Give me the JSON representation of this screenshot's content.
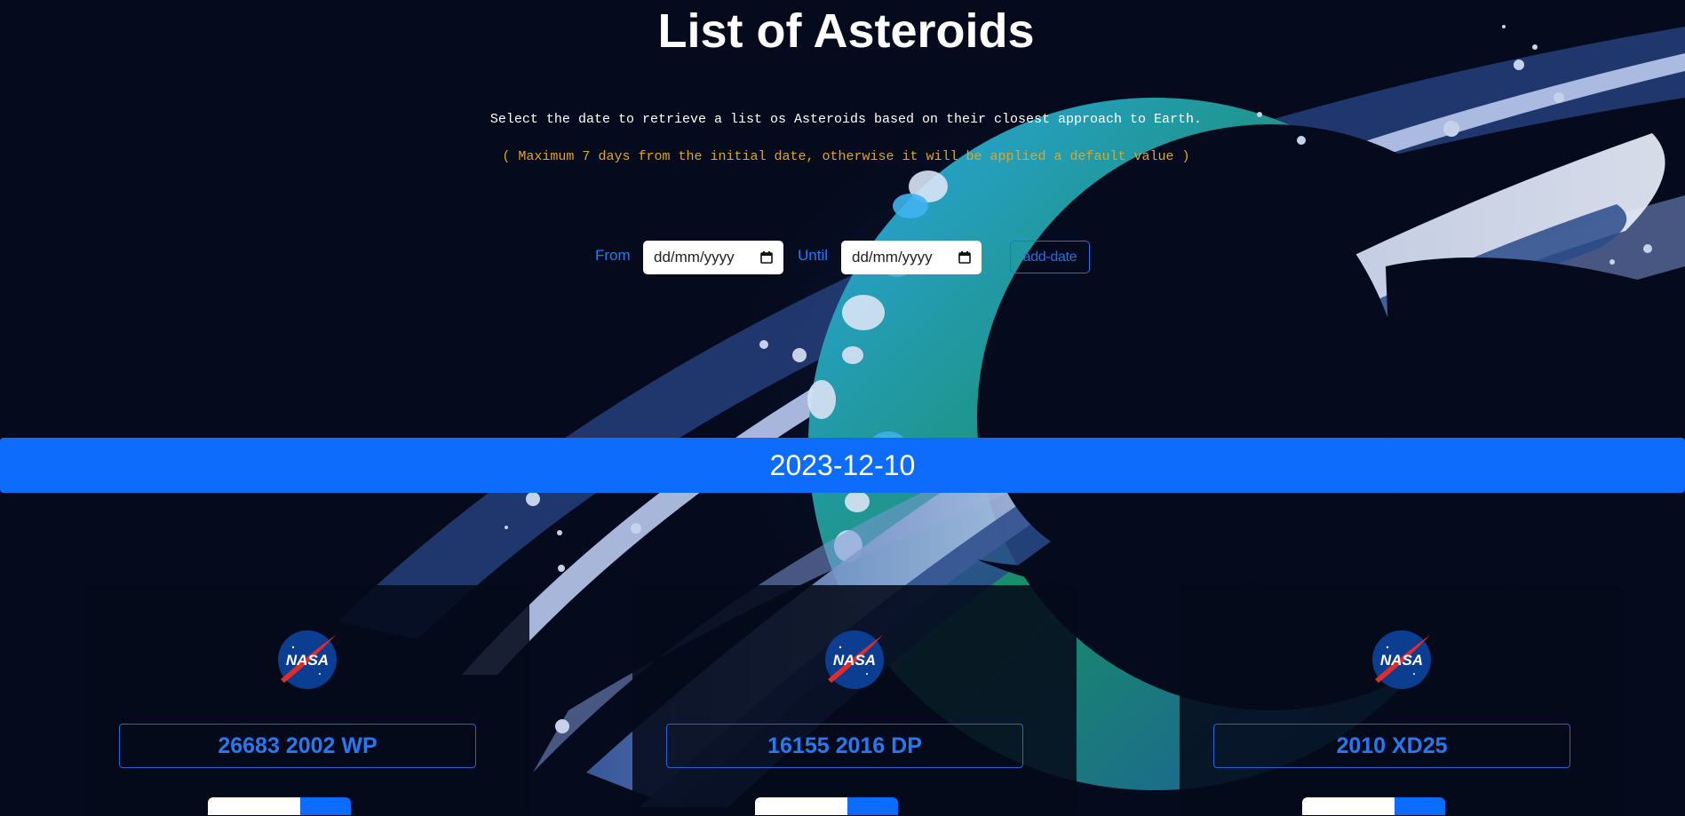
{
  "header": {
    "title": "List of Asteroids",
    "subtitle": "Select the date to retrieve a list os Asteroids based on their closest approach to Earth.",
    "note": "( Maximum 7 days from the initial date, otherwise it will be applied a default value )"
  },
  "form": {
    "from_label": "From",
    "from_value": "dd/mm/yyyy",
    "until_label": "Until",
    "until_value": "dd/mm/yyyy",
    "submit_label": "add-date"
  },
  "date_header": "2023-12-10",
  "asteroids": [
    {
      "name": "26683 2002 WP",
      "logo": "nasa-logo"
    },
    {
      "name": "16155 2016 DP",
      "logo": "nasa-logo"
    },
    {
      "name": "2010 XD25",
      "logo": "nasa-logo"
    }
  ],
  "logo_text": "NASA",
  "colors": {
    "background": "#050a1c",
    "accent": "#0e6cfd",
    "note": "#e0a52a",
    "title": "#ffffff"
  }
}
